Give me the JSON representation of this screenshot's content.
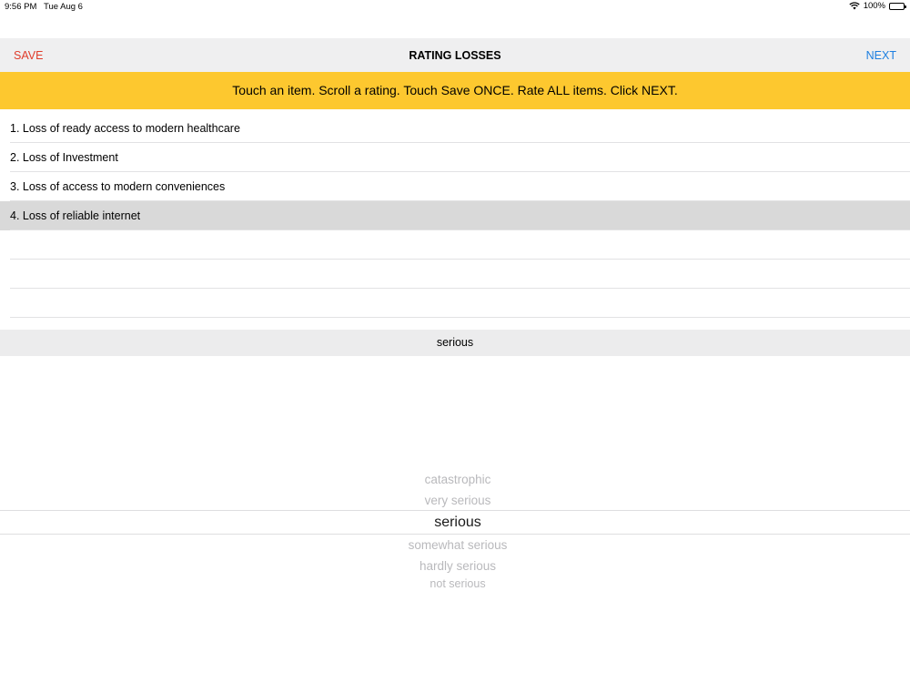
{
  "status": {
    "time": "9:56 PM",
    "date": "Tue Aug 6",
    "battery": "100%"
  },
  "nav": {
    "save_label": "SAVE",
    "title": "RATING LOSSES",
    "next_label": "NEXT"
  },
  "instruction": "Touch an item. Scroll a rating. Touch Save ONCE. Rate ALL items. Click NEXT.",
  "items": [
    "1. Loss of ready access to modern healthcare",
    "2. Loss of Investment",
    "3. Loss of access to modern conveniences",
    "4. Loss of reliable internet"
  ],
  "selected_item_index": 3,
  "current_rating": "serious",
  "picker": {
    "options": [
      "catastrophic",
      "very serious",
      "serious",
      "somewhat serious",
      "hardly serious",
      "not serious"
    ],
    "selected": "serious"
  },
  "colors": {
    "save": "#e03c2b",
    "next": "#1d7fe0",
    "banner": "#fdc82f"
  }
}
